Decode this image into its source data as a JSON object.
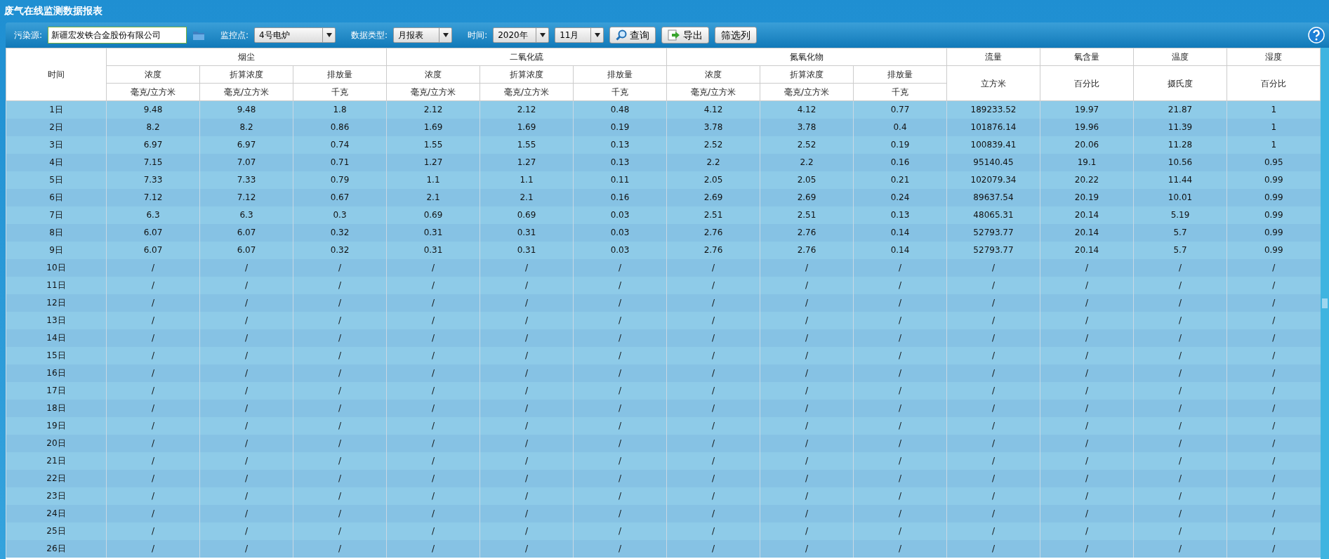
{
  "window": {
    "title": "废气在线监测数据报表"
  },
  "toolbar": {
    "fields": [
      {
        "kind": "text",
        "label": "污染源:",
        "value": "新疆宏发铁合金股份有限公司"
      },
      {
        "kind": "select",
        "label": "监控点:",
        "value": "4号电炉"
      },
      {
        "kind": "select",
        "label": "数据类型:",
        "value": "月报表"
      },
      {
        "kind": "select",
        "label": "时间:",
        "value": "2020年"
      },
      {
        "kind": "select",
        "value": "11月"
      }
    ],
    "buttons": [
      {
        "label": "查询",
        "kind": "search"
      },
      {
        "label": "导出",
        "kind": "export"
      },
      {
        "label": "筛选列",
        "kind": "plain"
      }
    ]
  },
  "table": {
    "time_header": "时间",
    "groups": [
      {
        "kind": "group",
        "title": "烟尘",
        "columns": [
          {
            "name": "浓度",
            "unit": "毫克/立方米"
          },
          {
            "name": "折算浓度",
            "unit": "毫克/立方米"
          },
          {
            "name": "排放量",
            "unit": "千克"
          }
        ]
      },
      {
        "kind": "group",
        "title": "二氧化硫",
        "columns": [
          {
            "name": "浓度",
            "unit": "毫克/立方米"
          },
          {
            "name": "折算浓度",
            "unit": "毫克/立方米"
          },
          {
            "name": "排放量",
            "unit": "千克"
          }
        ]
      },
      {
        "kind": "group",
        "title": "氮氧化物",
        "columns": [
          {
            "name": "浓度",
            "unit": "毫克/立方米"
          },
          {
            "name": "折算浓度",
            "unit": "毫克/立方米"
          },
          {
            "name": "排放量",
            "unit": "千克"
          }
        ]
      },
      {
        "kind": "single",
        "title": "流量",
        "unit": "立方米"
      },
      {
        "kind": "single",
        "title": "氧含量",
        "unit": "百分比"
      },
      {
        "kind": "single",
        "title": "温度",
        "unit": "摄氏度"
      },
      {
        "kind": "single",
        "title": "湿度",
        "unit": "百分比"
      }
    ],
    "rows": [
      [
        "1日",
        "9.48",
        "9.48",
        "1.8",
        "2.12",
        "2.12",
        "0.48",
        "4.12",
        "4.12",
        "0.77",
        "189233.52",
        "19.97",
        "21.87",
        "1"
      ],
      [
        "2日",
        "8.2",
        "8.2",
        "0.86",
        "1.69",
        "1.69",
        "0.19",
        "3.78",
        "3.78",
        "0.4",
        "101876.14",
        "19.96",
        "11.39",
        "1"
      ],
      [
        "3日",
        "6.97",
        "6.97",
        "0.74",
        "1.55",
        "1.55",
        "0.13",
        "2.52",
        "2.52",
        "0.19",
        "100839.41",
        "20.06",
        "11.28",
        "1"
      ],
      [
        "4日",
        "7.15",
        "7.07",
        "0.71",
        "1.27",
        "1.27",
        "0.13",
        "2.2",
        "2.2",
        "0.16",
        "95140.45",
        "19.1",
        "10.56",
        "0.95"
      ],
      [
        "5日",
        "7.33",
        "7.33",
        "0.79",
        "1.1",
        "1.1",
        "0.11",
        "2.05",
        "2.05",
        "0.21",
        "102079.34",
        "20.22",
        "11.44",
        "0.99"
      ],
      [
        "6日",
        "7.12",
        "7.12",
        "0.67",
        "2.1",
        "2.1",
        "0.16",
        "2.69",
        "2.69",
        "0.24",
        "89637.54",
        "20.19",
        "10.01",
        "0.99"
      ],
      [
        "7日",
        "6.3",
        "6.3",
        "0.3",
        "0.69",
        "0.69",
        "0.03",
        "2.51",
        "2.51",
        "0.13",
        "48065.31",
        "20.14",
        "5.19",
        "0.99"
      ],
      [
        "8日",
        "6.07",
        "6.07",
        "0.32",
        "0.31",
        "0.31",
        "0.03",
        "2.76",
        "2.76",
        "0.14",
        "52793.77",
        "20.14",
        "5.7",
        "0.99"
      ],
      [
        "9日",
        "6.07",
        "6.07",
        "0.32",
        "0.31",
        "0.31",
        "0.03",
        "2.76",
        "2.76",
        "0.14",
        "52793.77",
        "20.14",
        "5.7",
        "0.99"
      ],
      [
        "10日",
        "/",
        "/",
        "/",
        "/",
        "/",
        "/",
        "/",
        "/",
        "/",
        "/",
        "/",
        "/",
        "/"
      ],
      [
        "11日",
        "/",
        "/",
        "/",
        "/",
        "/",
        "/",
        "/",
        "/",
        "/",
        "/",
        "/",
        "/",
        "/"
      ],
      [
        "12日",
        "/",
        "/",
        "/",
        "/",
        "/",
        "/",
        "/",
        "/",
        "/",
        "/",
        "/",
        "/",
        "/"
      ],
      [
        "13日",
        "/",
        "/",
        "/",
        "/",
        "/",
        "/",
        "/",
        "/",
        "/",
        "/",
        "/",
        "/",
        "/"
      ],
      [
        "14日",
        "/",
        "/",
        "/",
        "/",
        "/",
        "/",
        "/",
        "/",
        "/",
        "/",
        "/",
        "/",
        "/"
      ],
      [
        "15日",
        "/",
        "/",
        "/",
        "/",
        "/",
        "/",
        "/",
        "/",
        "/",
        "/",
        "/",
        "/",
        "/"
      ],
      [
        "16日",
        "/",
        "/",
        "/",
        "/",
        "/",
        "/",
        "/",
        "/",
        "/",
        "/",
        "/",
        "/",
        "/"
      ],
      [
        "17日",
        "/",
        "/",
        "/",
        "/",
        "/",
        "/",
        "/",
        "/",
        "/",
        "/",
        "/",
        "/",
        "/"
      ],
      [
        "18日",
        "/",
        "/",
        "/",
        "/",
        "/",
        "/",
        "/",
        "/",
        "/",
        "/",
        "/",
        "/",
        "/"
      ],
      [
        "19日",
        "/",
        "/",
        "/",
        "/",
        "/",
        "/",
        "/",
        "/",
        "/",
        "/",
        "/",
        "/",
        "/"
      ],
      [
        "20日",
        "/",
        "/",
        "/",
        "/",
        "/",
        "/",
        "/",
        "/",
        "/",
        "/",
        "/",
        "/",
        "/"
      ],
      [
        "21日",
        "/",
        "/",
        "/",
        "/",
        "/",
        "/",
        "/",
        "/",
        "/",
        "/",
        "/",
        "/",
        "/"
      ],
      [
        "22日",
        "/",
        "/",
        "/",
        "/",
        "/",
        "/",
        "/",
        "/",
        "/",
        "/",
        "/",
        "/",
        "/"
      ],
      [
        "23日",
        "/",
        "/",
        "/",
        "/",
        "/",
        "/",
        "/",
        "/",
        "/",
        "/",
        "/",
        "/",
        "/"
      ],
      [
        "24日",
        "/",
        "/",
        "/",
        "/",
        "/",
        "/",
        "/",
        "/",
        "/",
        "/",
        "/",
        "/",
        "/"
      ],
      [
        "25日",
        "/",
        "/",
        "/",
        "/",
        "/",
        "/",
        "/",
        "/",
        "/",
        "/",
        "/",
        "/",
        "/"
      ],
      [
        "26日",
        "/",
        "/",
        "/",
        "/",
        "/",
        "/",
        "/",
        "/",
        "/",
        "/",
        "/",
        "/",
        "/"
      ]
    ]
  }
}
